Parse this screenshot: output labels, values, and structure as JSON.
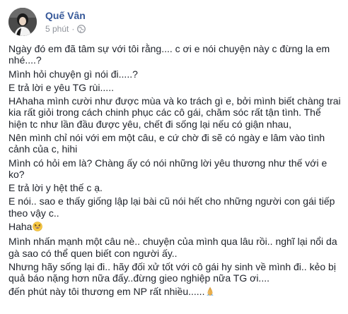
{
  "post": {
    "author": "Quế Vân",
    "time": "5 phút",
    "separator": "·",
    "privacy_icon": "globe-icon",
    "avatar_icon": "profile-photo",
    "emoji_laugh": "grinning-squinting-face-emoji",
    "emoji_pray": "folded-hands-emoji",
    "lines": [
      "Ngày đó em đã tâm sự với tôi rằng.... c ơi e nói chuyện này c đừng la em nhé....?",
      "Mình hỏi chuyện gì nói đi.....?",
      "E trả lời e yêu TG rùi.....",
      "HAhaha mình cười như được mùa và ko trách gì e, bởi mình biết chàng trai kia rất giỏi trong cách chinh phục các cô gái, chăm sóc rất tận tình. Thể hiện tc như lần đầu được yêu, chết đi sống lại nếu có giận nhau,",
      "Nên mình chỉ nói với em một câu, e cứ chờ đi sẽ có ngày e lâm vào tình cảnh của c, hihi",
      "Mình có hỏi em là? Chàng ấy có nói những lời yêu thương như thế với e ko?",
      "E trả lời y hệt thế c ạ.",
      "E nói.. sao e thấy giống lập lại bài cũ nói hết cho những người con gái tiếp theo vậy c..",
      "Haha",
      "Mình nhấn mạnh một câu nè.. chuyện của mình qua lâu rồi.. nghĩ lại nổi da gà sao có thể quen biết con người ấy..",
      "Nhưng hãy sống lại đi.. hãy đối xử tốt với cô gái hy sinh về mình đi.. kẻo bị quả báo nặng hơn nữa đấy..đừng gieo nghiệp nữa TG ơi....",
      "đến phút này tôi thương em NP rất nhiều......"
    ]
  }
}
